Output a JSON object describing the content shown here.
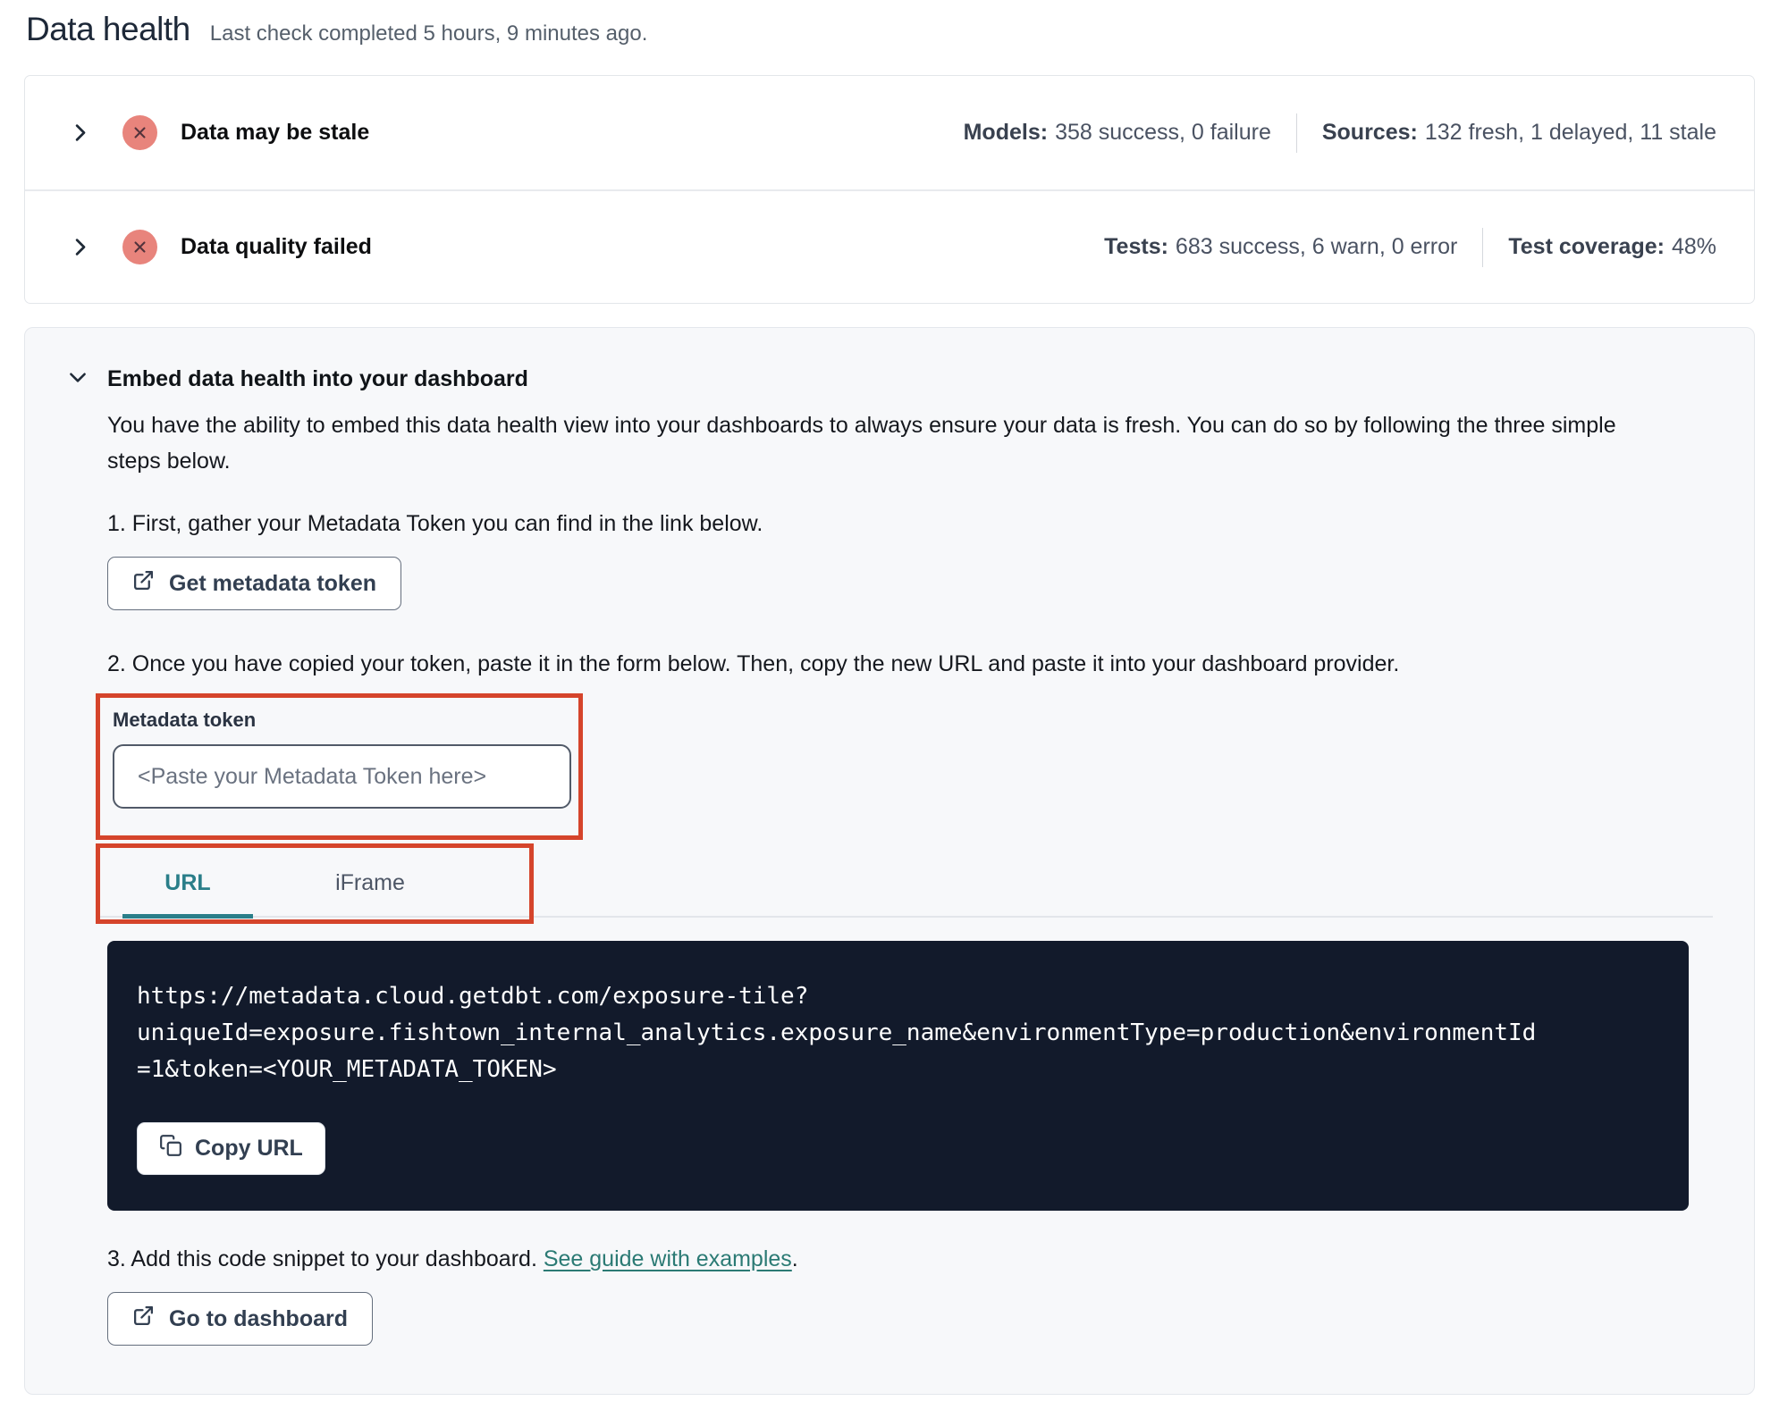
{
  "page": {
    "title": "Data health",
    "subtitle": "Last check completed 5 hours, 9 minutes ago."
  },
  "status_rows": [
    {
      "label": "Data may be stale",
      "status_icon": "error-x-circle",
      "stats": [
        {
          "label": "Models:",
          "value": "358 success, 0 failure"
        },
        {
          "label": "Sources:",
          "value": "132 fresh, 1 delayed, 11 stale"
        }
      ]
    },
    {
      "label": "Data quality failed",
      "status_icon": "error-x-circle",
      "stats": [
        {
          "label": "Tests:",
          "value": "683 success, 6 warn, 0 error"
        },
        {
          "label": "Test coverage:",
          "value": "48%"
        }
      ]
    }
  ],
  "embed": {
    "title": "Embed data health into your dashboard",
    "description": "You have the ability to embed this data health view into your dashboards to always ensure your data is fresh. You can do so by following the three simple steps below.",
    "step1": {
      "text": "1. First, gather your Metadata Token you can find in the link below.",
      "button_label": "Get metadata token",
      "button_icon": "external-link"
    },
    "step2": {
      "text": "2. Once you have copied your token, paste it in the form below. Then, copy the new URL and paste it into your dashboard provider.",
      "token_label": "Metadata token",
      "token_placeholder": "<Paste your Metadata Token here>",
      "tabs": [
        {
          "label": "URL",
          "active": true
        },
        {
          "label": "iFrame",
          "active": false
        }
      ],
      "code_url": "https://metadata.cloud.getdbt.com/exposure-tile?uniqueId=exposure.fishtown_internal_analytics.exposure_name&environmentType=production&environmentId=1&token=<YOUR_METADATA_TOKEN>",
      "code_url_lines": [
        "https://metadata.cloud.getdbt.com/exposure-tile?",
        "uniqueId=exposure.fishtown_internal_analytics.exposure_name&environmentType=production&environmentId",
        "=1&token=<YOUR_METADATA_TOKEN>"
      ],
      "copy_button_label": "Copy URL",
      "copy_button_icon": "copy"
    },
    "step3": {
      "text_before_link": "3. Add this code snippet to your dashboard. ",
      "link_label": "See guide with examples",
      "text_after_link": ".",
      "button_label": "Go to dashboard",
      "button_icon": "external-link"
    }
  },
  "colors": {
    "annotation_red": "#d5442b",
    "error_badge": "#e8847c",
    "active_tab_teal": "#2a7e89",
    "link_teal": "#2b7a74",
    "code_background": "#121a2b",
    "panel_background": "#f7f8fa"
  }
}
